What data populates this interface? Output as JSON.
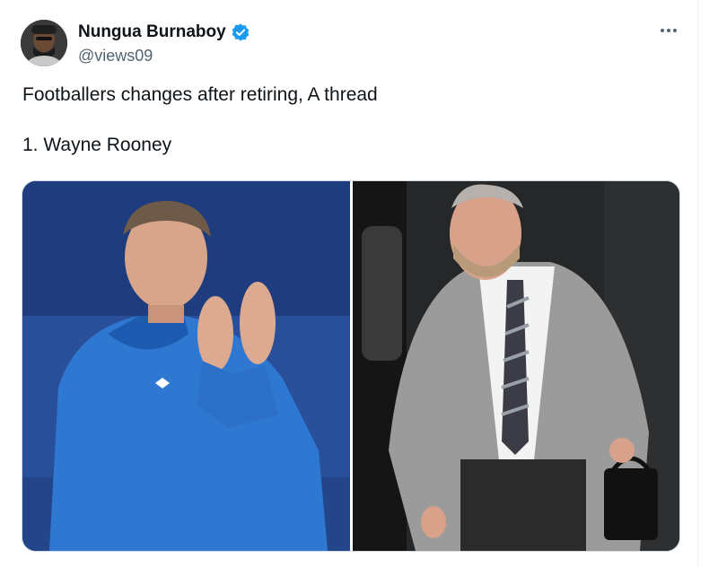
{
  "tweet": {
    "author": {
      "display_name": "Nungua Burnaboy",
      "handle": "@views09",
      "verified": true,
      "avatar_icon": "profile-avatar"
    },
    "more_icon": "more-dots-icon",
    "text": "Footballers changes after retiring, A thread\n\n1. Wayne Rooney",
    "media": [
      {
        "name": "photo-rooney-player"
      },
      {
        "name": "photo-rooney-retired"
      }
    ]
  },
  "colors": {
    "verified_blue": "#1d9bf0",
    "handle_gray": "#536471",
    "text": "#0f1419",
    "border": "#cfd9de"
  }
}
